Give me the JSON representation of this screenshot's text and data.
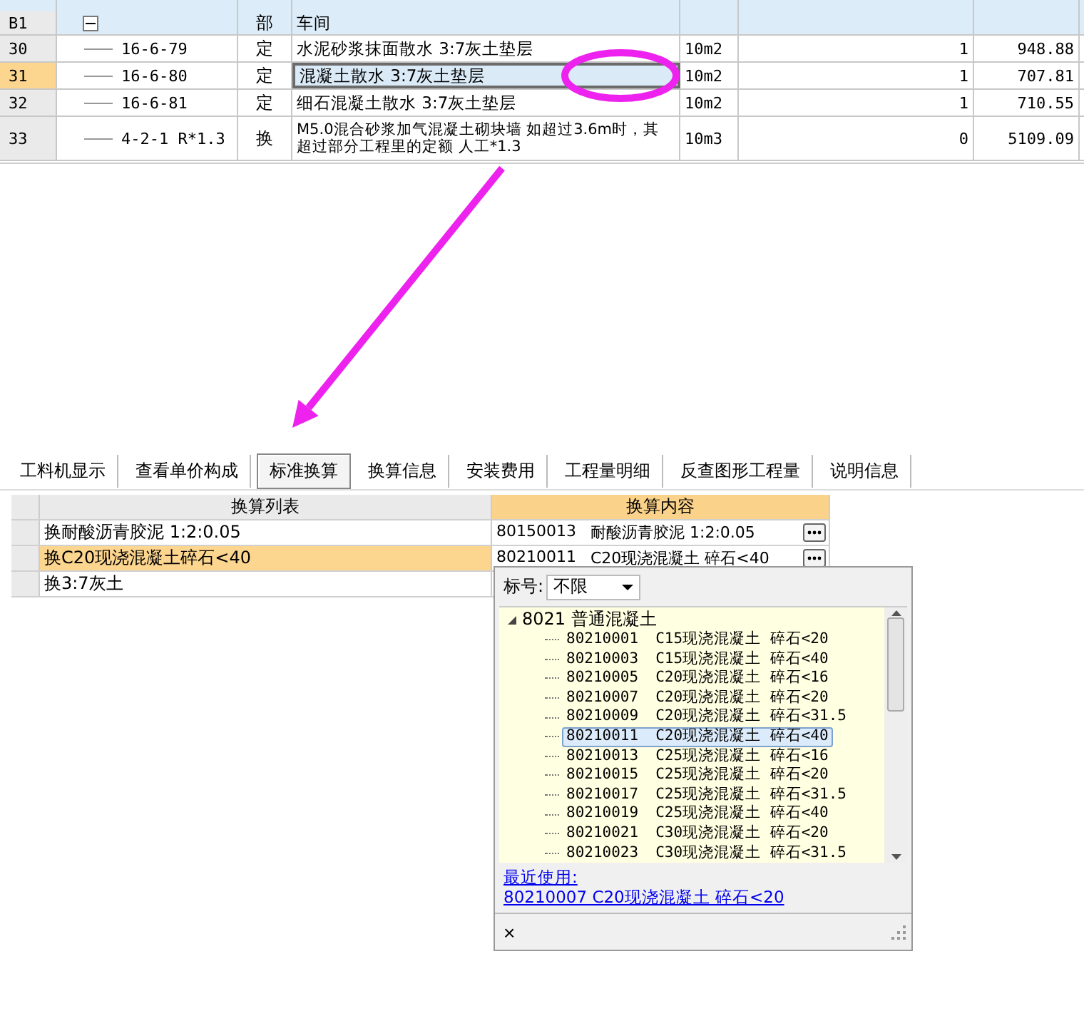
{
  "top_table": {
    "rows": [
      {
        "number": "B1",
        "kind": "section",
        "expanded": true,
        "code": "",
        "type": "部",
        "name": "车间",
        "unit": "",
        "quantity": "",
        "price": "",
        "selected": false
      },
      {
        "number": "30",
        "kind": "item",
        "code": "16-6-79",
        "type": "定",
        "name": "水泥砂浆抹面散水 3:7灰土垫层",
        "unit": "10m2",
        "quantity": "1",
        "price": "948.88",
        "selected": false
      },
      {
        "number": "31",
        "kind": "item",
        "code": "16-6-80",
        "type": "定",
        "name": "混凝土散水 3:7灰土垫层",
        "unit": "10m2",
        "quantity": "1",
        "price": "707.81",
        "selected": true
      },
      {
        "number": "32",
        "kind": "item",
        "code": "16-6-81",
        "type": "定",
        "name": "细石混凝土散水 3:7灰土垫层",
        "unit": "10m2",
        "quantity": "1",
        "price": "710.55",
        "selected": false
      },
      {
        "number": "33",
        "kind": "item",
        "code": "4-2-1 R*1.3",
        "type": "换",
        "name": "M5.0混合砂浆加气混凝土砌块墙 如超过3.6m时，其超过部分工程里的定额 人工*1.3",
        "unit": "10m3",
        "quantity": "0",
        "price": "5109.09",
        "selected": false
      }
    ]
  },
  "tabs": [
    {
      "label": "工料机显示",
      "selected": false
    },
    {
      "label": "查看单价构成",
      "selected": false
    },
    {
      "label": "标准换算",
      "selected": true
    },
    {
      "label": "换算信息",
      "selected": false
    },
    {
      "label": "安装费用",
      "selected": false
    },
    {
      "label": "工程量明细",
      "selected": false
    },
    {
      "label": "反查图形工程量",
      "selected": false
    },
    {
      "label": "说明信息",
      "selected": false
    }
  ],
  "conversion_table": {
    "columns": [
      "换算列表",
      "换算内容"
    ],
    "rows": [
      {
        "item": "换耐酸沥青胶泥 1:2:0.05",
        "content_code": "80150013",
        "content_name": "耐酸沥青胶泥 1:2:0.05",
        "selected": false
      },
      {
        "item": "换C20现浇混凝土碎石<40",
        "content_code": "80210011",
        "content_name": "C20现浇混凝土 碎石<40",
        "selected": true
      },
      {
        "item": "换3:7灰土",
        "content_code": "",
        "content_name": "",
        "selected": false
      }
    ]
  },
  "dropdown": {
    "grade_label": "标号:",
    "grade_value": "不限",
    "tree": {
      "label": "8021 普通混凝土",
      "expanded": true,
      "children": [
        {
          "code": "80210001",
          "name": "C15现浇混凝土 碎石<20",
          "selected": false
        },
        {
          "code": "80210003",
          "name": "C15现浇混凝土 碎石<40",
          "selected": false
        },
        {
          "code": "80210005",
          "name": "C20现浇混凝土 碎石<16",
          "selected": false
        },
        {
          "code": "80210007",
          "name": "C20现浇混凝土 碎石<20",
          "selected": false
        },
        {
          "code": "80210009",
          "name": "C20现浇混凝土 碎石<31.5",
          "selected": false
        },
        {
          "code": "80210011",
          "name": "C20现浇混凝土 碎石<40",
          "selected": true
        },
        {
          "code": "80210013",
          "name": "C25现浇混凝土 碎石<16",
          "selected": false
        },
        {
          "code": "80210015",
          "name": "C25现浇混凝土 碎石<20",
          "selected": false
        },
        {
          "code": "80210017",
          "name": "C25现浇混凝土 碎石<31.5",
          "selected": false
        },
        {
          "code": "80210019",
          "name": "C25现浇混凝土 碎石<40",
          "selected": false
        },
        {
          "code": "80210021",
          "name": "C30现浇混凝土 碎石<20",
          "selected": false
        },
        {
          "code": "80210023",
          "name": "C30现浇混凝土 碎石<31.5",
          "selected": false
        }
      ]
    },
    "recent_label": "最近使用:",
    "recent_link": "80210007 C20现浇混凝土 碎石<20",
    "close": "×"
  }
}
